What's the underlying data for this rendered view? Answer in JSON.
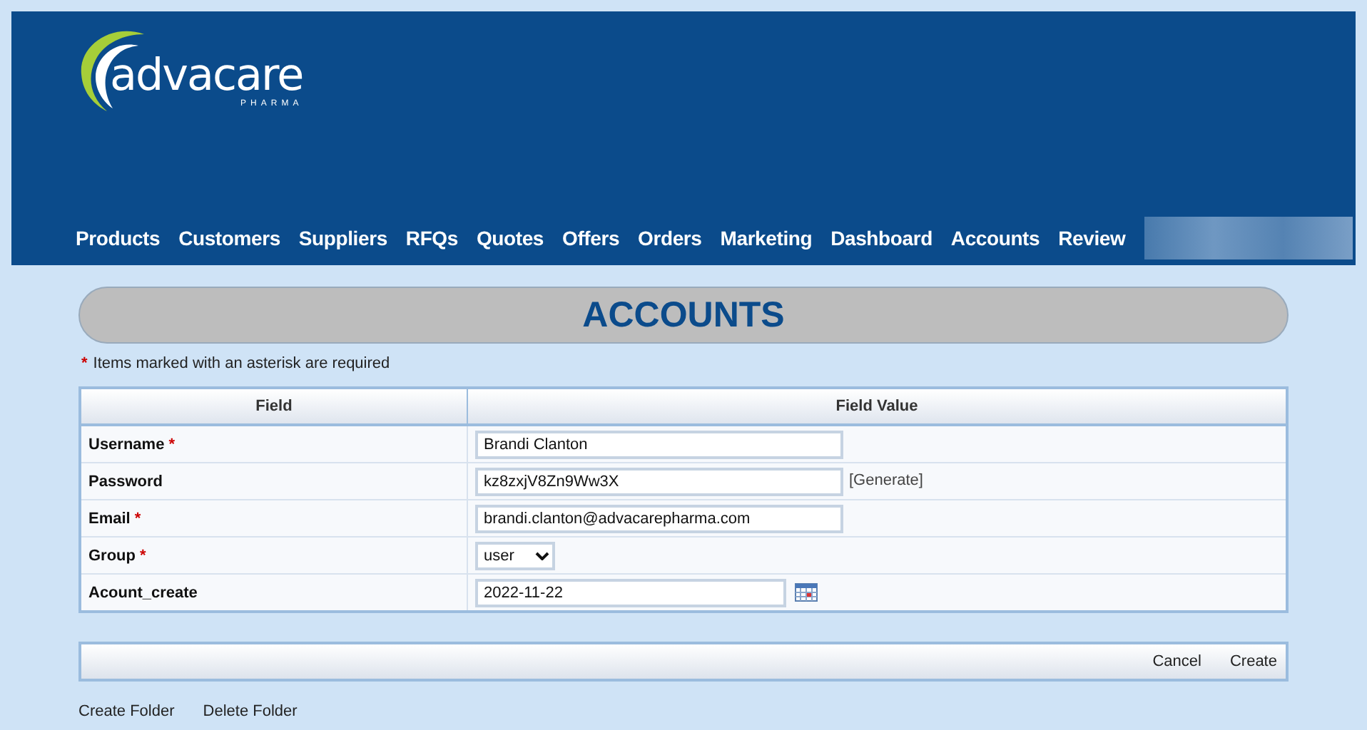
{
  "logo": {
    "wordmark": "advacare",
    "tagline": "PHARMA"
  },
  "nav": [
    {
      "label": "Products",
      "selected": false
    },
    {
      "label": "Customers",
      "selected": false
    },
    {
      "label": "Suppliers",
      "selected": false
    },
    {
      "label": "RFQs",
      "selected": false
    },
    {
      "label": "Quotes",
      "selected": false
    },
    {
      "label": "Offers",
      "selected": false
    },
    {
      "label": "Orders",
      "selected": false
    },
    {
      "label": "Marketing",
      "selected": false
    },
    {
      "label": "Dashboard",
      "selected": false
    },
    {
      "label": "Accounts",
      "selected": false
    },
    {
      "label": "Review",
      "selected": false
    }
  ],
  "page_title": "ACCOUNTS",
  "required_note": {
    "mark": "*",
    "text": "Items marked with an asterisk are required"
  },
  "table": {
    "columns": [
      "Field",
      "Field Value"
    ],
    "rows": [
      {
        "kind": "text",
        "field": "Username",
        "required": true,
        "value": "Brandi Clanton"
      },
      {
        "kind": "password",
        "field": "Password",
        "required": false,
        "value": "kz8zxjV8Zn9Ww3X",
        "action": "[Generate]"
      },
      {
        "kind": "text",
        "field": "Email",
        "required": true,
        "value": "brandi.clanton@advacarepharma.com"
      },
      {
        "kind": "select",
        "field": "Group",
        "required": true,
        "value": "user"
      },
      {
        "kind": "date",
        "field": "Acount_create",
        "required": false,
        "value": "2022-11-22"
      }
    ]
  },
  "form_buttons": [
    "Cancel",
    "Create"
  ],
  "footer_links": [
    "Create Folder",
    "Delete Folder"
  ]
}
